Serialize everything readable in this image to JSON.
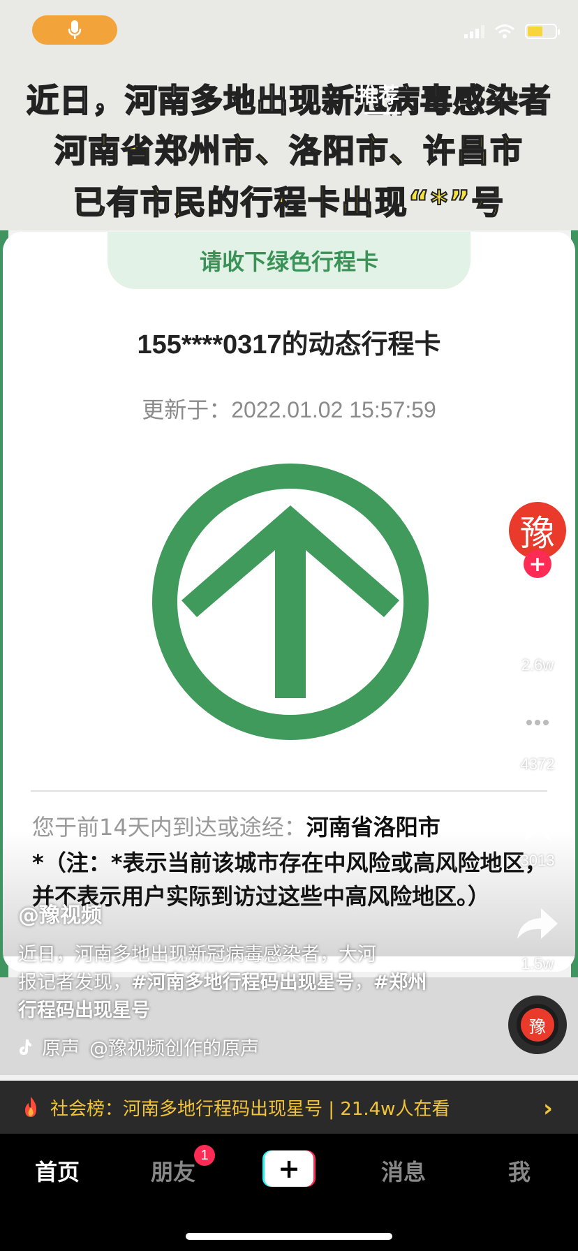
{
  "status_bar": {
    "mic_icon": "mic-icon",
    "signal_icon": "cellular-signal-icon",
    "wifi_icon": "wifi-icon",
    "battery_icon": "battery-charging-icon"
  },
  "top_tab": {
    "label": "推荐"
  },
  "headline": {
    "line1": "近日，河南多地出现新冠病毒感染者",
    "line2": "河南省郑州市、洛阳市、许昌市",
    "line3": "已有市民的行程卡出现“*”号"
  },
  "card": {
    "banner": "请收下绿色行程卡",
    "title": "155****0317的动态行程卡",
    "updated": "更新于：2022.01.02 15:57:59",
    "route_label": "您于前14天内到达或途经：",
    "route_value": "河南省洛阳市",
    "note": "*（注：*表示当前该城市存在中风险或高风险地区，并不表示用户实际到访过这些中高风险地区。）",
    "arrow_color": "#3f9a5c"
  },
  "rail": {
    "avatar_text": "豫",
    "follow_label": "+",
    "like_count": "2.6w",
    "comment_count": "4372",
    "favorite_count": "3013",
    "share_count": "1.5w"
  },
  "caption": {
    "author": "@豫视频",
    "text_line1": "近日，河南多地出现新冠病毒感染者，大河",
    "text_line2_prefix": "报记者发现，",
    "hashtag1": "#河南多地行程码出现星号",
    "separator": "，",
    "hashtag2": "#郑州行程码出现星号",
    "music_original": "原声",
    "music_credit": "@豫视频创作的原声"
  },
  "hotbar": {
    "text": "社会榜：河南多地行程码出现星号 | 21.4w人在看",
    "accent": "#f2c43a"
  },
  "nav": {
    "home": "首页",
    "friends": "朋友",
    "friends_badge": "1",
    "create": "+",
    "messages": "消息",
    "me": "我"
  }
}
